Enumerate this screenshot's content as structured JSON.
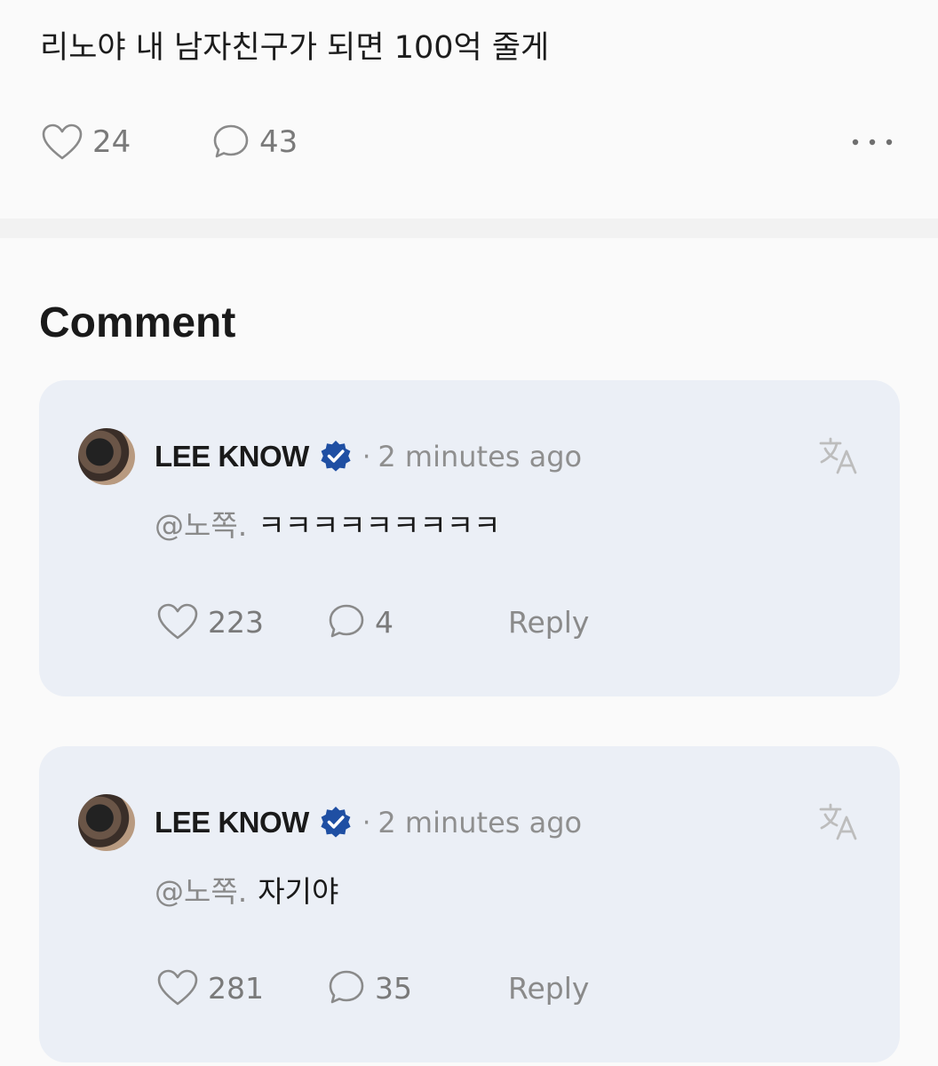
{
  "post": {
    "text": "리노야 내 남자친구가 되면 100억 줄게",
    "likes": "24",
    "comments": "43"
  },
  "comments_section": {
    "title": "Comment",
    "items": [
      {
        "author": "LEE KNOW",
        "separator": "·",
        "time": "2 minutes ago",
        "mention": "@노쪽.",
        "text": "ㅋㅋㅋㅋㅋㅋㅋㅋㅋ",
        "likes": "223",
        "replies": "4",
        "reply_label": "Reply"
      },
      {
        "author": "LEE KNOW",
        "separator": "·",
        "time": "2 minutes ago",
        "mention": "@노쪽.",
        "text": "자기야",
        "likes": "281",
        "replies": "35",
        "reply_label": "Reply"
      }
    ]
  },
  "colors": {
    "verified_badge": "#1f4fa3",
    "card_background": "#ebeff6",
    "page_background": "#fafafa",
    "muted_text": "#8f8f8f"
  },
  "icons": [
    "heart-icon",
    "comment-bubble-icon",
    "more-dots-icon",
    "verified-badge-icon",
    "translate-icon"
  ]
}
